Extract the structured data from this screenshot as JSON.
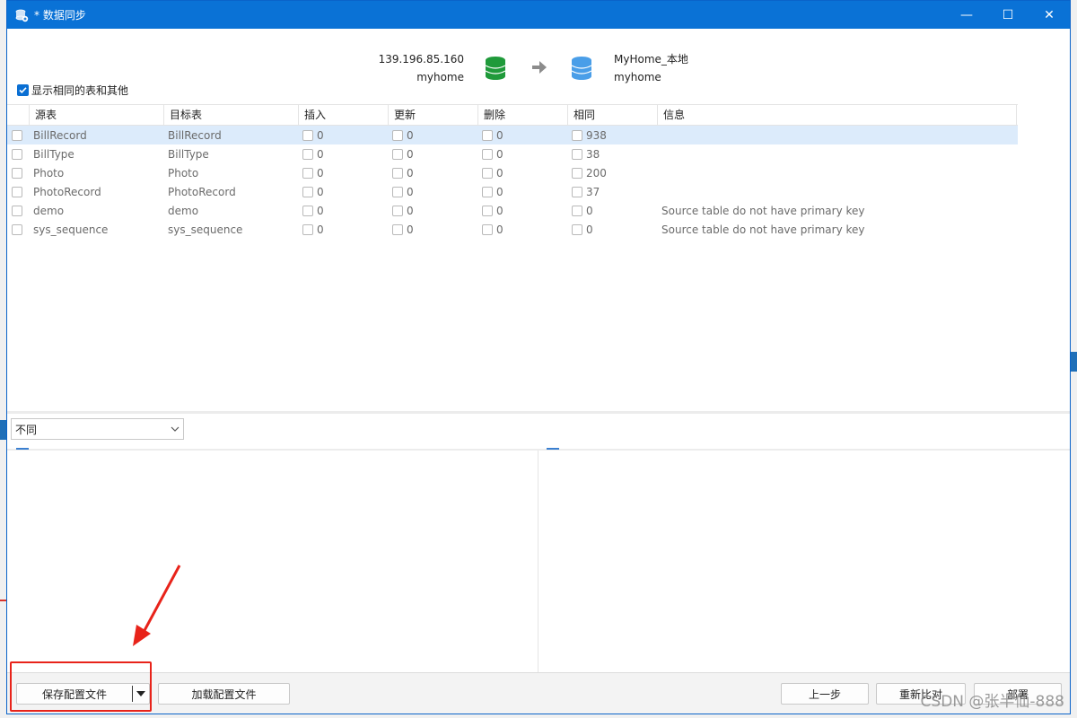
{
  "window": {
    "title": "* 数据同步",
    "controls": {
      "minimize": "—",
      "maximize": "☐",
      "close": "✕"
    }
  },
  "header": {
    "source": {
      "host": "139.196.85.160",
      "db": "myhome",
      "color": "#1f9a3a"
    },
    "target": {
      "host": "MyHome_本地",
      "db": "myhome",
      "color": "#4a9ee8"
    }
  },
  "show_same": {
    "label": "显示相同的表和其他",
    "checked": true
  },
  "grid": {
    "columns": [
      "源表",
      "目标表",
      "插入",
      "更新",
      "删除",
      "相同",
      "信息"
    ],
    "rows": [
      {
        "source": "BillRecord",
        "target": "BillRecord",
        "insert": "0",
        "update": "0",
        "delete": "0",
        "same": "938",
        "info": "",
        "selected": true
      },
      {
        "source": "BillType",
        "target": "BillType",
        "insert": "0",
        "update": "0",
        "delete": "0",
        "same": "38",
        "info": ""
      },
      {
        "source": "Photo",
        "target": "Photo",
        "insert": "0",
        "update": "0",
        "delete": "0",
        "same": "200",
        "info": ""
      },
      {
        "source": "PhotoRecord",
        "target": "PhotoRecord",
        "insert": "0",
        "update": "0",
        "delete": "0",
        "same": "37",
        "info": ""
      },
      {
        "source": "demo",
        "target": "demo",
        "insert": "0",
        "update": "0",
        "delete": "0",
        "same": "0",
        "info": "Source table do not have primary key"
      },
      {
        "source": "sys_sequence",
        "target": "sys_sequence",
        "insert": "0",
        "update": "0",
        "delete": "0",
        "same": "0",
        "info": "Source table do not have primary key"
      }
    ]
  },
  "filter": {
    "selected": "不同"
  },
  "footer": {
    "save_config": "保存配置文件",
    "load_config": "加载配置文件",
    "prev": "上一步",
    "recompare": "重新比对",
    "deploy": "部署"
  },
  "watermark": "CSDN @张半仙-888",
  "colors": {
    "titlebar": "#0a72d6",
    "accent": "#0a6fd3",
    "selection": "#dcebfb",
    "annotation": "#e8231a"
  }
}
